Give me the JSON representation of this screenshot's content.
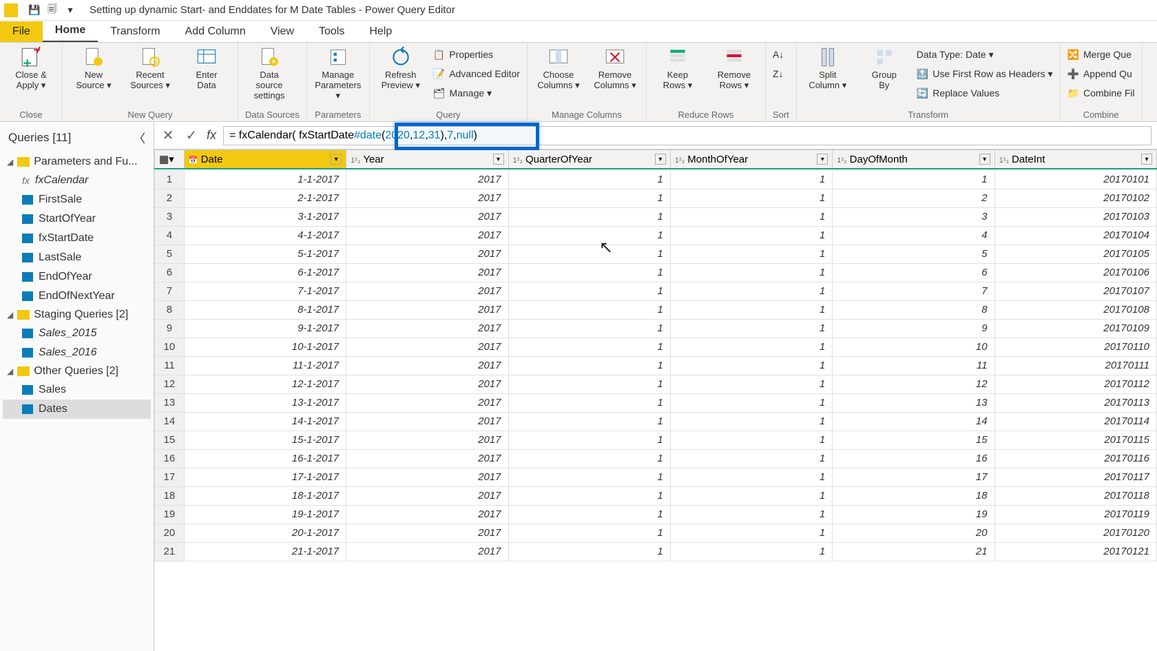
{
  "title": "Setting up dynamic Start- and Enddates for M Date Tables - Power Query Editor",
  "tabs": {
    "file": "File",
    "home": "Home",
    "transform": "Transform",
    "addColumn": "Add Column",
    "view": "View",
    "tools": "Tools",
    "help": "Help"
  },
  "ribbon": {
    "closeApply": "Close &\nApply ▾",
    "closeGrp": "Close",
    "newSource": "New\nSource ▾",
    "recentSources": "Recent\nSources ▾",
    "enterData": "Enter\nData",
    "newQueryGrp": "New Query",
    "dataSource": "Data source\nsettings",
    "dataSourcesGrp": "Data Sources",
    "manageParams": "Manage\nParameters ▾",
    "paramsGrp": "Parameters",
    "refresh": "Refresh\nPreview ▾",
    "properties": "Properties",
    "advEditor": "Advanced Editor",
    "manage": "Manage ▾",
    "queryGrp": "Query",
    "chooseCols": "Choose\nColumns ▾",
    "removeCols": "Remove\nColumns ▾",
    "manageColsGrp": "Manage Columns",
    "keepRows": "Keep\nRows ▾",
    "removeRows": "Remove\nRows ▾",
    "reduceGrp": "Reduce Rows",
    "sort": "Sort",
    "splitCol": "Split\nColumn ▾",
    "groupBy": "Group\nBy",
    "dataType": "Data Type: Date ▾",
    "firstRow": "Use First Row as Headers ▾",
    "replace": "Replace Values",
    "transformGrp": "Transform",
    "mergeQ": "Merge Que",
    "appendQ": "Append Qu",
    "combineF": "Combine Fil",
    "combineGrp": "Combine"
  },
  "queriesPane": {
    "header": "Queries [11]",
    "group1": "Parameters and Fu...",
    "fxCalendar": "fxCalendar",
    "firstSale": "FirstSale",
    "startOfYear": "StartOfYear",
    "fxStartDate": "fxStartDate",
    "lastSale": "LastSale",
    "endOfYear": "EndOfYear",
    "endOfNextYear": "EndOfNextYear",
    "group2": "Staging Queries [2]",
    "sales2015": "Sales_2015",
    "sales2016": "Sales_2016",
    "group3": "Other Queries [2]",
    "sales": "Sales",
    "dates": "Dates"
  },
  "formula": {
    "pre": "= fxCalendar( fxStartDate ",
    "hl_kw": "#date",
    "hl_open": "( ",
    "hl_n1": "2020",
    "hl_sep1": ", ",
    "hl_n2": "12",
    "hl_sep2": ", ",
    "hl_n3": "31",
    "hl_close": ")",
    "post1": ", ",
    "seven": "7",
    "post2": ", ",
    "null": "null",
    "post3": ")"
  },
  "columns": [
    "Date",
    "Year",
    "QuarterOfYear",
    "MonthOfYear",
    "DayOfMonth",
    "DateInt"
  ],
  "colTypes": [
    "📅",
    "1²₃",
    "1²₃",
    "1²₃",
    "1²₃",
    "1²₃"
  ],
  "rows": [
    {
      "n": 1,
      "date": "1-1-2017",
      "year": 2017,
      "q": 1,
      "m": 1,
      "d": 1,
      "di": 20170101
    },
    {
      "n": 2,
      "date": "2-1-2017",
      "year": 2017,
      "q": 1,
      "m": 1,
      "d": 2,
      "di": 20170102
    },
    {
      "n": 3,
      "date": "3-1-2017",
      "year": 2017,
      "q": 1,
      "m": 1,
      "d": 3,
      "di": 20170103
    },
    {
      "n": 4,
      "date": "4-1-2017",
      "year": 2017,
      "q": 1,
      "m": 1,
      "d": 4,
      "di": 20170104
    },
    {
      "n": 5,
      "date": "5-1-2017",
      "year": 2017,
      "q": 1,
      "m": 1,
      "d": 5,
      "di": 20170105
    },
    {
      "n": 6,
      "date": "6-1-2017",
      "year": 2017,
      "q": 1,
      "m": 1,
      "d": 6,
      "di": 20170106
    },
    {
      "n": 7,
      "date": "7-1-2017",
      "year": 2017,
      "q": 1,
      "m": 1,
      "d": 7,
      "di": 20170107
    },
    {
      "n": 8,
      "date": "8-1-2017",
      "year": 2017,
      "q": 1,
      "m": 1,
      "d": 8,
      "di": 20170108
    },
    {
      "n": 9,
      "date": "9-1-2017",
      "year": 2017,
      "q": 1,
      "m": 1,
      "d": 9,
      "di": 20170109
    },
    {
      "n": 10,
      "date": "10-1-2017",
      "year": 2017,
      "q": 1,
      "m": 1,
      "d": 10,
      "di": 20170110
    },
    {
      "n": 11,
      "date": "11-1-2017",
      "year": 2017,
      "q": 1,
      "m": 1,
      "d": 11,
      "di": 20170111
    },
    {
      "n": 12,
      "date": "12-1-2017",
      "year": 2017,
      "q": 1,
      "m": 1,
      "d": 12,
      "di": 20170112
    },
    {
      "n": 13,
      "date": "13-1-2017",
      "year": 2017,
      "q": 1,
      "m": 1,
      "d": 13,
      "di": 20170113
    },
    {
      "n": 14,
      "date": "14-1-2017",
      "year": 2017,
      "q": 1,
      "m": 1,
      "d": 14,
      "di": 20170114
    },
    {
      "n": 15,
      "date": "15-1-2017",
      "year": 2017,
      "q": 1,
      "m": 1,
      "d": 15,
      "di": 20170115
    },
    {
      "n": 16,
      "date": "16-1-2017",
      "year": 2017,
      "q": 1,
      "m": 1,
      "d": 16,
      "di": 20170116
    },
    {
      "n": 17,
      "date": "17-1-2017",
      "year": 2017,
      "q": 1,
      "m": 1,
      "d": 17,
      "di": 20170117
    },
    {
      "n": 18,
      "date": "18-1-2017",
      "year": 2017,
      "q": 1,
      "m": 1,
      "d": 18,
      "di": 20170118
    },
    {
      "n": 19,
      "date": "19-1-2017",
      "year": 2017,
      "q": 1,
      "m": 1,
      "d": 19,
      "di": 20170119
    },
    {
      "n": 20,
      "date": "20-1-2017",
      "year": 2017,
      "q": 1,
      "m": 1,
      "d": 20,
      "di": 20170120
    },
    {
      "n": 21,
      "date": "21-1-2017",
      "year": 2017,
      "q": 1,
      "m": 1,
      "d": 21,
      "di": 20170121
    }
  ]
}
